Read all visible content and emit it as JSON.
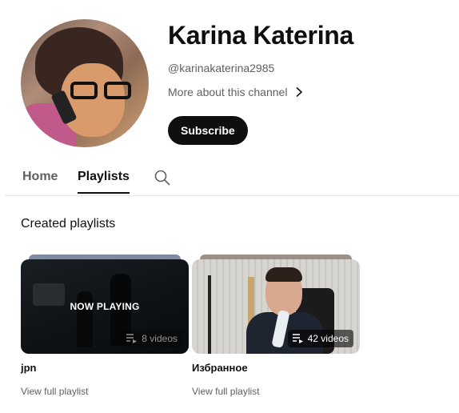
{
  "channel": {
    "name": "Karina Katerina",
    "handle": "@karinakaterina2985",
    "about_label": "More about this channel",
    "subscribe_label": "Subscribe"
  },
  "tabs": [
    {
      "label": "Home",
      "selected": false
    },
    {
      "label": "Playlists",
      "selected": true
    }
  ],
  "section": {
    "title": "Created playlists"
  },
  "playlists": [
    {
      "title": "jpn",
      "video_count": "8 videos",
      "overlay_text": "NOW PLAYING",
      "link_label": "View full playlist"
    },
    {
      "title": "Избранное",
      "video_count": "42 videos",
      "link_label": "View full playlist"
    }
  ],
  "icons": {
    "tab_search": "search-icon",
    "about": "chevron-right-icon",
    "playlist": "playlist-icon"
  },
  "colors": {
    "text_primary": "#0f0f0f",
    "text_secondary": "#606060",
    "subscribe_bg": "#0f0f0f",
    "divider": "#e5e5e5"
  }
}
